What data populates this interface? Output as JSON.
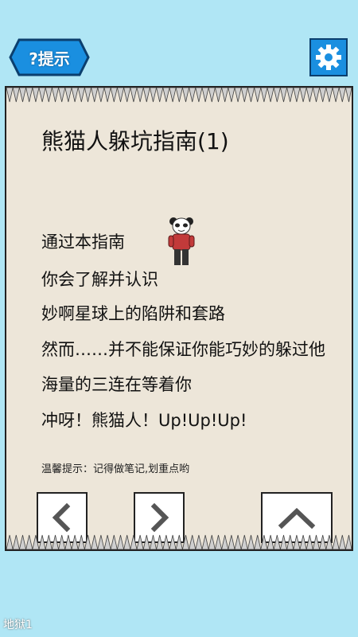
{
  "header": {
    "hint_label": "?提示",
    "settings_icon": "gear-icon"
  },
  "panel": {
    "title": "熊猫人躲坑指南(1)",
    "lines": [
      "通过本指南",
      "你会了解并认识",
      "妙啊星球上的陷阱和套路",
      "然而……并不能保证你能巧妙的躲过他",
      "海量的三连在等着你",
      "冲呀！熊猫人！Up!Up!Up!"
    ],
    "tip": "温馨提示：记得做笔记,划重点哟"
  },
  "nav": {
    "prev_icon": "chevron-left-icon",
    "next_icon": "chevron-right-icon",
    "up_icon": "chevron-up-icon"
  },
  "footer": {
    "level_label": "地狱1"
  },
  "colors": {
    "background": "#b0e6f5",
    "panel": "#ede6d9",
    "accent": "#1a8fe0"
  }
}
